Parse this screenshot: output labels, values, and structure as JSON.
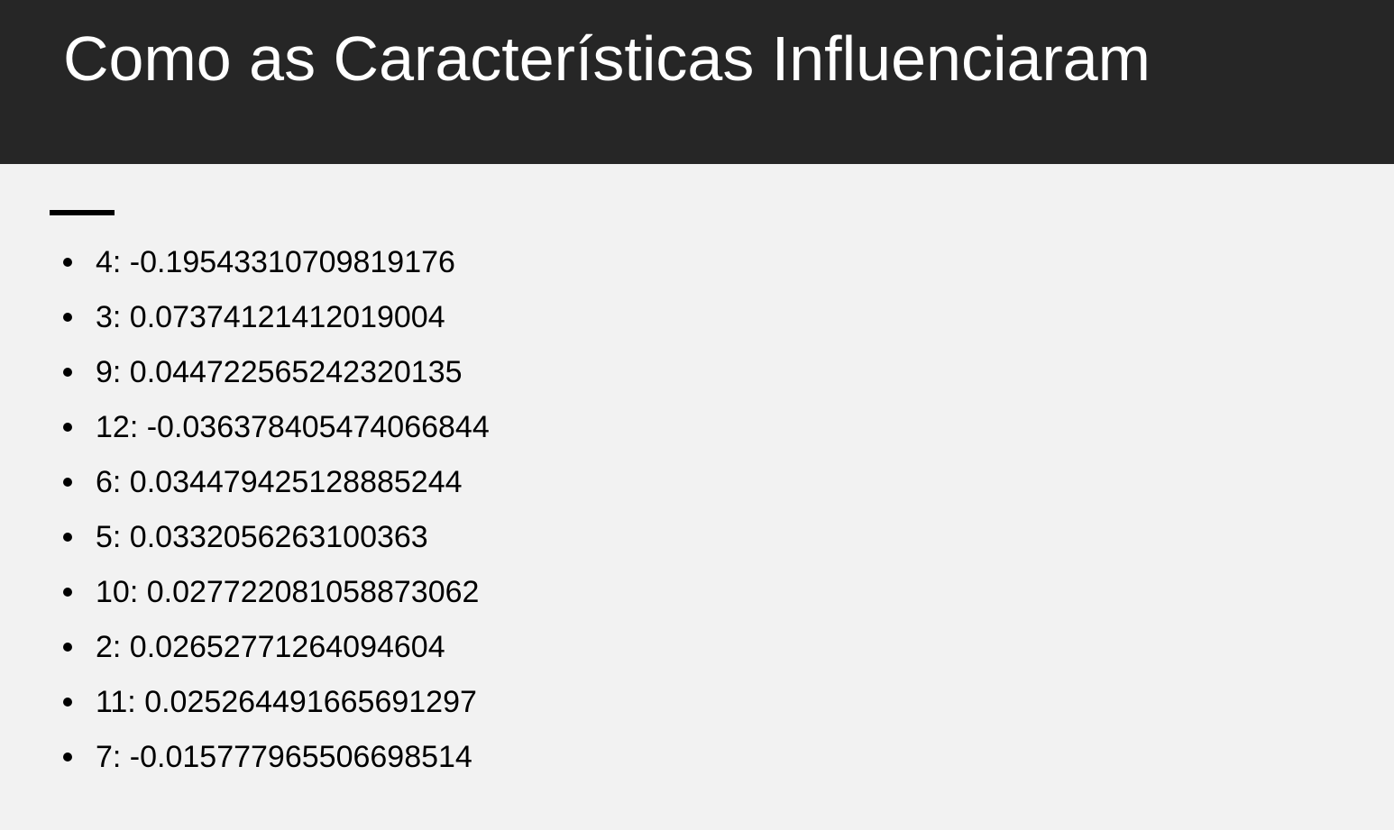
{
  "slide": {
    "title": "Como as Características Influenciaram",
    "items": [
      "4: -0.19543310709819176",
      "3: 0.07374121412019004",
      "9: 0.044722565242320135",
      "12: -0.036378405474066844",
      "6: 0.034479425128885244",
      "5: 0.0332056263100363",
      "10: 0.027722081058873062",
      "2: 0.02652771264094604",
      "11: 0.025264491665691297",
      "7: -0.015777965506698514"
    ]
  },
  "colors": {
    "title_bar": "#262626",
    "title_text": "#ffffff",
    "background": "#f2f2f2",
    "body_text": "#000000"
  }
}
